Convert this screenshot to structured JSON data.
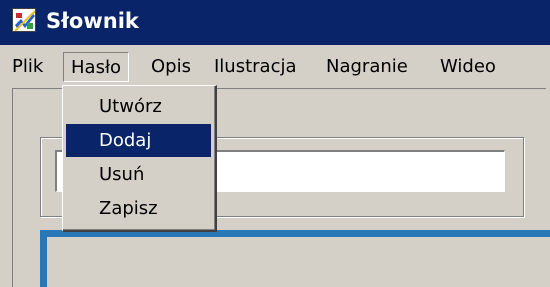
{
  "window": {
    "title": "Słownik",
    "icon": "dictionary-app-icon"
  },
  "menubar": {
    "items": [
      {
        "label": "Plik"
      },
      {
        "label": "Hasło"
      },
      {
        "label": "Opis"
      },
      {
        "label": "Ilustracja"
      },
      {
        "label": "Nagranie"
      },
      {
        "label": "Wideo"
      }
    ]
  },
  "dropdown": {
    "open_menu": "Hasło",
    "items": [
      {
        "label": "Utwórz"
      },
      {
        "label": "Dodaj",
        "selected": true
      },
      {
        "label": "Usuń"
      },
      {
        "label": "Zapisz"
      }
    ]
  },
  "main": {
    "entry_value": ""
  },
  "colors": {
    "titlebar": "#0a246a",
    "menu_highlight": "#0a246a",
    "face": "#d4d0c8",
    "panel_border": "#2878b8"
  }
}
